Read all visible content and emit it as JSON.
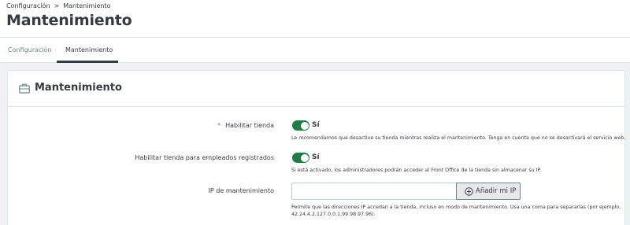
{
  "breadcrumb": {
    "parent": "Configuración",
    "separator": ">",
    "current": "Mantenimiento"
  },
  "header": {
    "title": "Mantenimiento"
  },
  "tabs": [
    {
      "label": "Configuración"
    },
    {
      "label": "Mantenimiento",
      "active": true
    }
  ],
  "card": {
    "title": "Mantenimiento",
    "icon": "briefcase-icon"
  },
  "form": {
    "enable_shop": {
      "required_mark": "*",
      "label": "Habilitar tienda",
      "toggle_value": "Sí",
      "enabled": true,
      "help": "Le recomendamos que desactive su tienda mientras realiza el mantenimiento. Tenga en cuenta que no se desactivará el servicio web."
    },
    "enable_shop_employees": {
      "label": "Habilitar tienda para empleados registrados",
      "toggle_value": "Sí",
      "enabled": true,
      "help": "Si está activado, los administradores podrán acceder al Front Office de la tienda sin almacenar su IP."
    },
    "maintenance_ip": {
      "label": "IP de mantenimiento",
      "value": "",
      "button_label": "Añadir mi IP",
      "button_icon": "plus-circle-icon",
      "help_line1": "Permite que las direcciones IP accedan a la tienda, incluso en modo de mantenimiento. Usa una coma para separarlas (por ejemplo,",
      "help_line2": "42.24.4.2,127.0.0.1,99.98.97.96)."
    }
  },
  "colors": {
    "toggle_on": "#1e7c44",
    "required": "#c05c67",
    "border": "#dbe6e9",
    "background": "#eff1f2"
  }
}
